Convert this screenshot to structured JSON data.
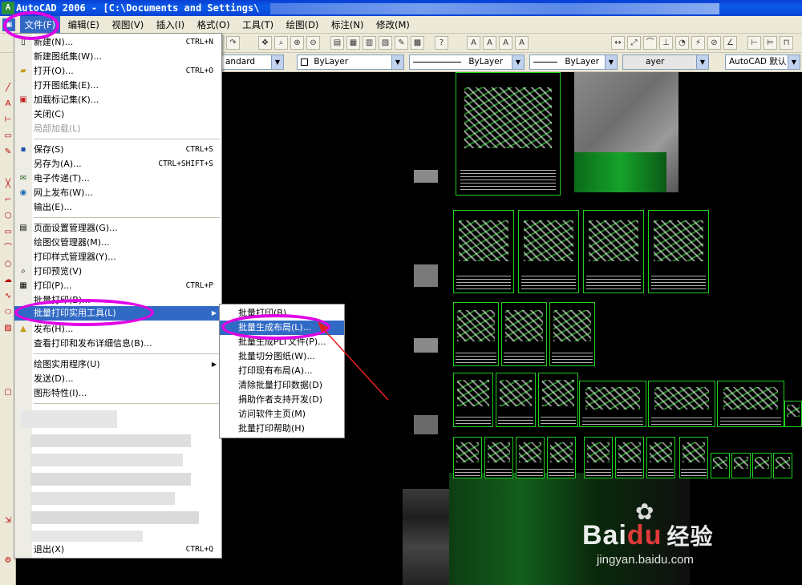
{
  "title_bar": {
    "text": "AutoCAD 2006 - [C:\\Documents and Settings\\"
  },
  "menu_bar": {
    "items": [
      "文件(F)",
      "编辑(E)",
      "视图(V)",
      "插入(I)",
      "格式(O)",
      "工具(T)",
      "绘图(D)",
      "标注(N)",
      "修改(M)"
    ]
  },
  "toolbar": {
    "text_style": "andard",
    "layer_color": "ByLayer",
    "linetype": "ByLayer",
    "lineweight": "ByLayer",
    "plot_style": "ayer",
    "workspace": "AutoCAD 默认"
  },
  "file_menu": {
    "items": [
      {
        "label": "新建(N)...",
        "shortcut": "CTRL+N",
        "icon": "new-document-icon"
      },
      {
        "label": "新建图纸集(W)...",
        "shortcut": "",
        "icon": ""
      },
      {
        "label": "打开(O)...",
        "shortcut": "CTRL+O",
        "icon": "open-folder-icon"
      },
      {
        "label": "打开图纸集(E)...",
        "shortcut": "",
        "icon": ""
      },
      {
        "label": "加载标记集(K)...",
        "shortcut": "",
        "icon": "markup-icon"
      },
      {
        "label": "关闭(C)",
        "shortcut": "",
        "icon": ""
      },
      {
        "label": "局部加载(L)",
        "shortcut": "",
        "icon": "",
        "disabled": true
      },
      {
        "label": "保存(S)",
        "shortcut": "CTRL+S",
        "icon": "save-icon"
      },
      {
        "label": "另存为(A)...",
        "shortcut": "CTRL+SHIFT+S",
        "icon": ""
      },
      {
        "label": "电子传递(T)...",
        "shortcut": "",
        "icon": "etransmit-icon"
      },
      {
        "label": "网上发布(W)...",
        "shortcut": "",
        "icon": "publish-web-icon"
      },
      {
        "label": "输出(E)...",
        "shortcut": "",
        "icon": ""
      },
      {
        "label": "页面设置管理器(G)...",
        "shortcut": "",
        "icon": "page-setup-icon"
      },
      {
        "label": "绘图仪管理器(M)...",
        "shortcut": "",
        "icon": ""
      },
      {
        "label": "打印样式管理器(Y)...",
        "shortcut": "",
        "icon": ""
      },
      {
        "label": "打印预览(V)",
        "shortcut": "",
        "icon": "print-preview-icon"
      },
      {
        "label": "打印(P)...",
        "shortcut": "CTRL+P",
        "icon": "printer-icon"
      },
      {
        "label": "批量打印(B)...",
        "shortcut": "",
        "icon": ""
      },
      {
        "label": "批量打印实用工具(L)",
        "shortcut": "",
        "icon": "",
        "submenu": true
      },
      {
        "label": "发布(H)...",
        "shortcut": "",
        "icon": "publish-icon"
      },
      {
        "label": "查看打印和发布详细信息(B)...",
        "shortcut": "",
        "icon": ""
      },
      {
        "label": "绘图实用程序(U)",
        "shortcut": "",
        "icon": "",
        "submenu": true
      },
      {
        "label": "发送(D)...",
        "shortcut": "",
        "icon": ""
      },
      {
        "label": "图形特性(I)...",
        "shortcut": "",
        "icon": ""
      },
      {
        "label": "退出(X)",
        "shortcut": "CTRL+Q",
        "icon": ""
      }
    ]
  },
  "sub_menu": {
    "items": [
      "批量打印(B)",
      "批量生成布局(L)...",
      "批量生成PLT文件(P)...",
      "批量切分图纸(W)...",
      "打印现有布局(A)...",
      "清除批量打印数据(D)",
      "捐助作者支持开发(D)",
      "访问软件主页(M)",
      "批量打印帮助(H)"
    ]
  },
  "watermark": {
    "brand_a": "Bai",
    "brand_b": "du",
    "brand_c": "经验",
    "url": "jingyan.baidu.com"
  },
  "colors": {
    "menu_highlight": "#316ac5",
    "annotation": "#e000e6",
    "sheet_border": "#1fd11f",
    "arrow": "#e02020"
  }
}
